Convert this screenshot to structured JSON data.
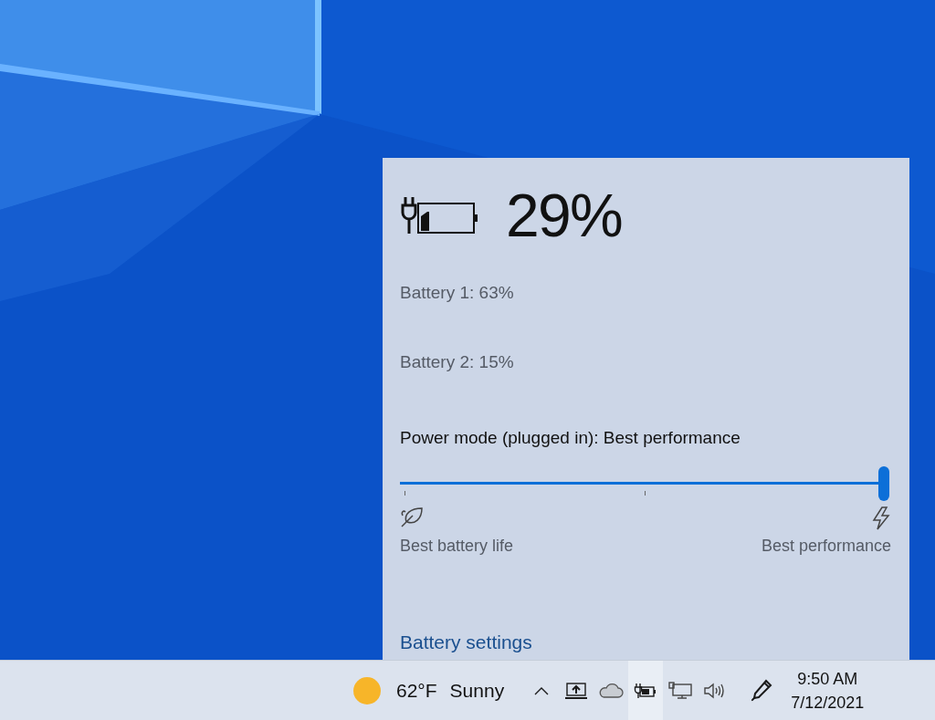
{
  "flyout": {
    "charge": "29%",
    "plugged_in": true,
    "batteries": [
      {
        "label": "Battery 1: 63%"
      },
      {
        "label": "Battery 2: 15%"
      }
    ],
    "power_mode": {
      "label": "Power mode (plugged in): Best performance",
      "level": 1,
      "min_label": "Best battery life",
      "max_label": "Best performance"
    },
    "settings_link": "Battery settings"
  },
  "taskbar": {
    "weather": {
      "temperature": "62°F",
      "condition": "Sunny"
    },
    "tray_icons": [
      {
        "kind": "chevron",
        "selected": false
      },
      {
        "kind": "projector",
        "selected": false
      },
      {
        "kind": "cloud",
        "selected": false
      },
      {
        "kind": "battery",
        "selected": true
      },
      {
        "kind": "network",
        "selected": false
      },
      {
        "kind": "volume",
        "selected": false
      },
      {
        "kind": "pen",
        "selected": false
      }
    ],
    "clock": {
      "time": "9:50 AM",
      "date": "7/12/2021"
    }
  }
}
